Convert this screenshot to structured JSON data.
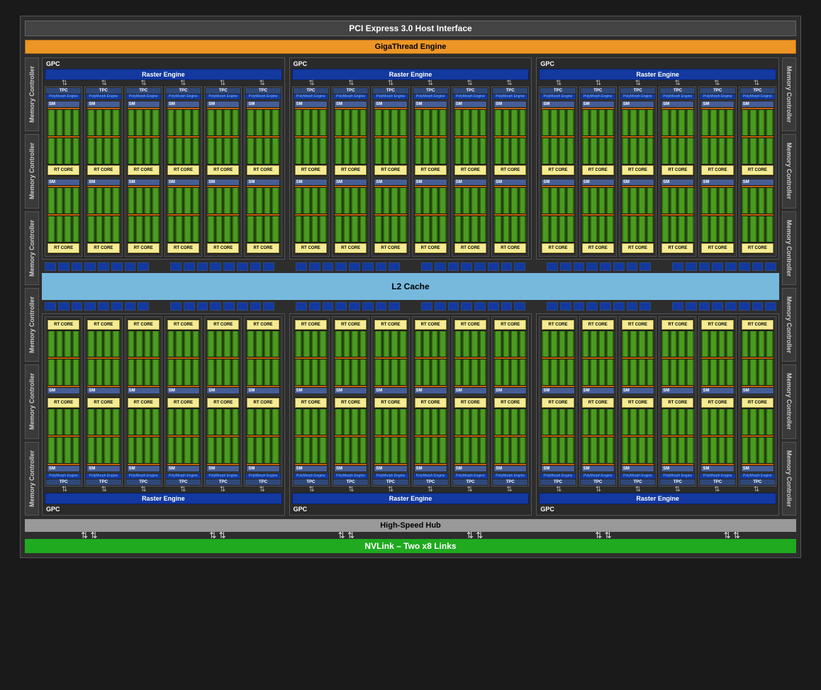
{
  "top": {
    "pci": "PCI Express 3.0 Host Interface",
    "giga": "GigaThread Engine"
  },
  "labels": {
    "memctrl": "Memory Controller",
    "gpc": "GPC",
    "raster": "Raster Engine",
    "tpc": "TPC",
    "poly": "PolyMorph Engine",
    "sm": "SM",
    "rt": "RT CORE",
    "l2": "L2 Cache",
    "hsh": "High-Speed Hub",
    "nvlink": "NVLink – Two x8 Links"
  },
  "layout": {
    "mem_per_side": 6,
    "gpc_rows": 2,
    "gpc_per_row": 3,
    "tpc_per_gpc": 6,
    "sm_per_tpc": 2,
    "cuda_cols": 4,
    "rom_groups": 6,
    "rom_per_group": 8,
    "nvlink_arrows": 6
  }
}
